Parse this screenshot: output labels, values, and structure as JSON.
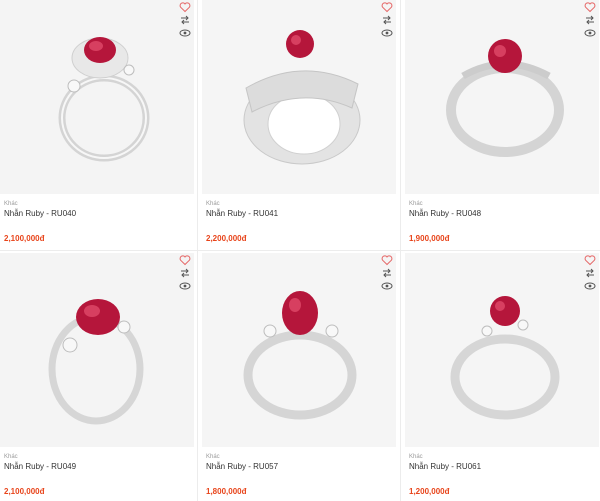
{
  "colors": {
    "price": "#e8441a",
    "ruby": "#b5163b",
    "ruby_light": "#e04a6a",
    "silver": "#d9d9d9",
    "action_heart": "#e56767",
    "action_icon": "#555555"
  },
  "icons": {
    "wishlist": "heart-icon",
    "compare": "compare-arrows-icon",
    "quickview": "eye-icon"
  },
  "products": [
    {
      "category": "Khác",
      "name": "Nhẫn Ruby - RU040",
      "price": "2,100,000đ"
    },
    {
      "category": "Khác",
      "name": "Nhẫn Ruby - RU041",
      "price": "2,200,000đ"
    },
    {
      "category": "Khác",
      "name": "Nhẫn Ruby - RU048",
      "price": "1,900,000đ"
    },
    {
      "category": "Khác",
      "name": "Nhẫn Ruby - RU049",
      "price": "2,100,000đ"
    },
    {
      "category": "Khác",
      "name": "Nhẫn Ruby - RU057",
      "price": "1,800,000đ"
    },
    {
      "category": "Khác",
      "name": "Nhẫn Ruby - RU061",
      "price": "1,200,000đ"
    }
  ]
}
